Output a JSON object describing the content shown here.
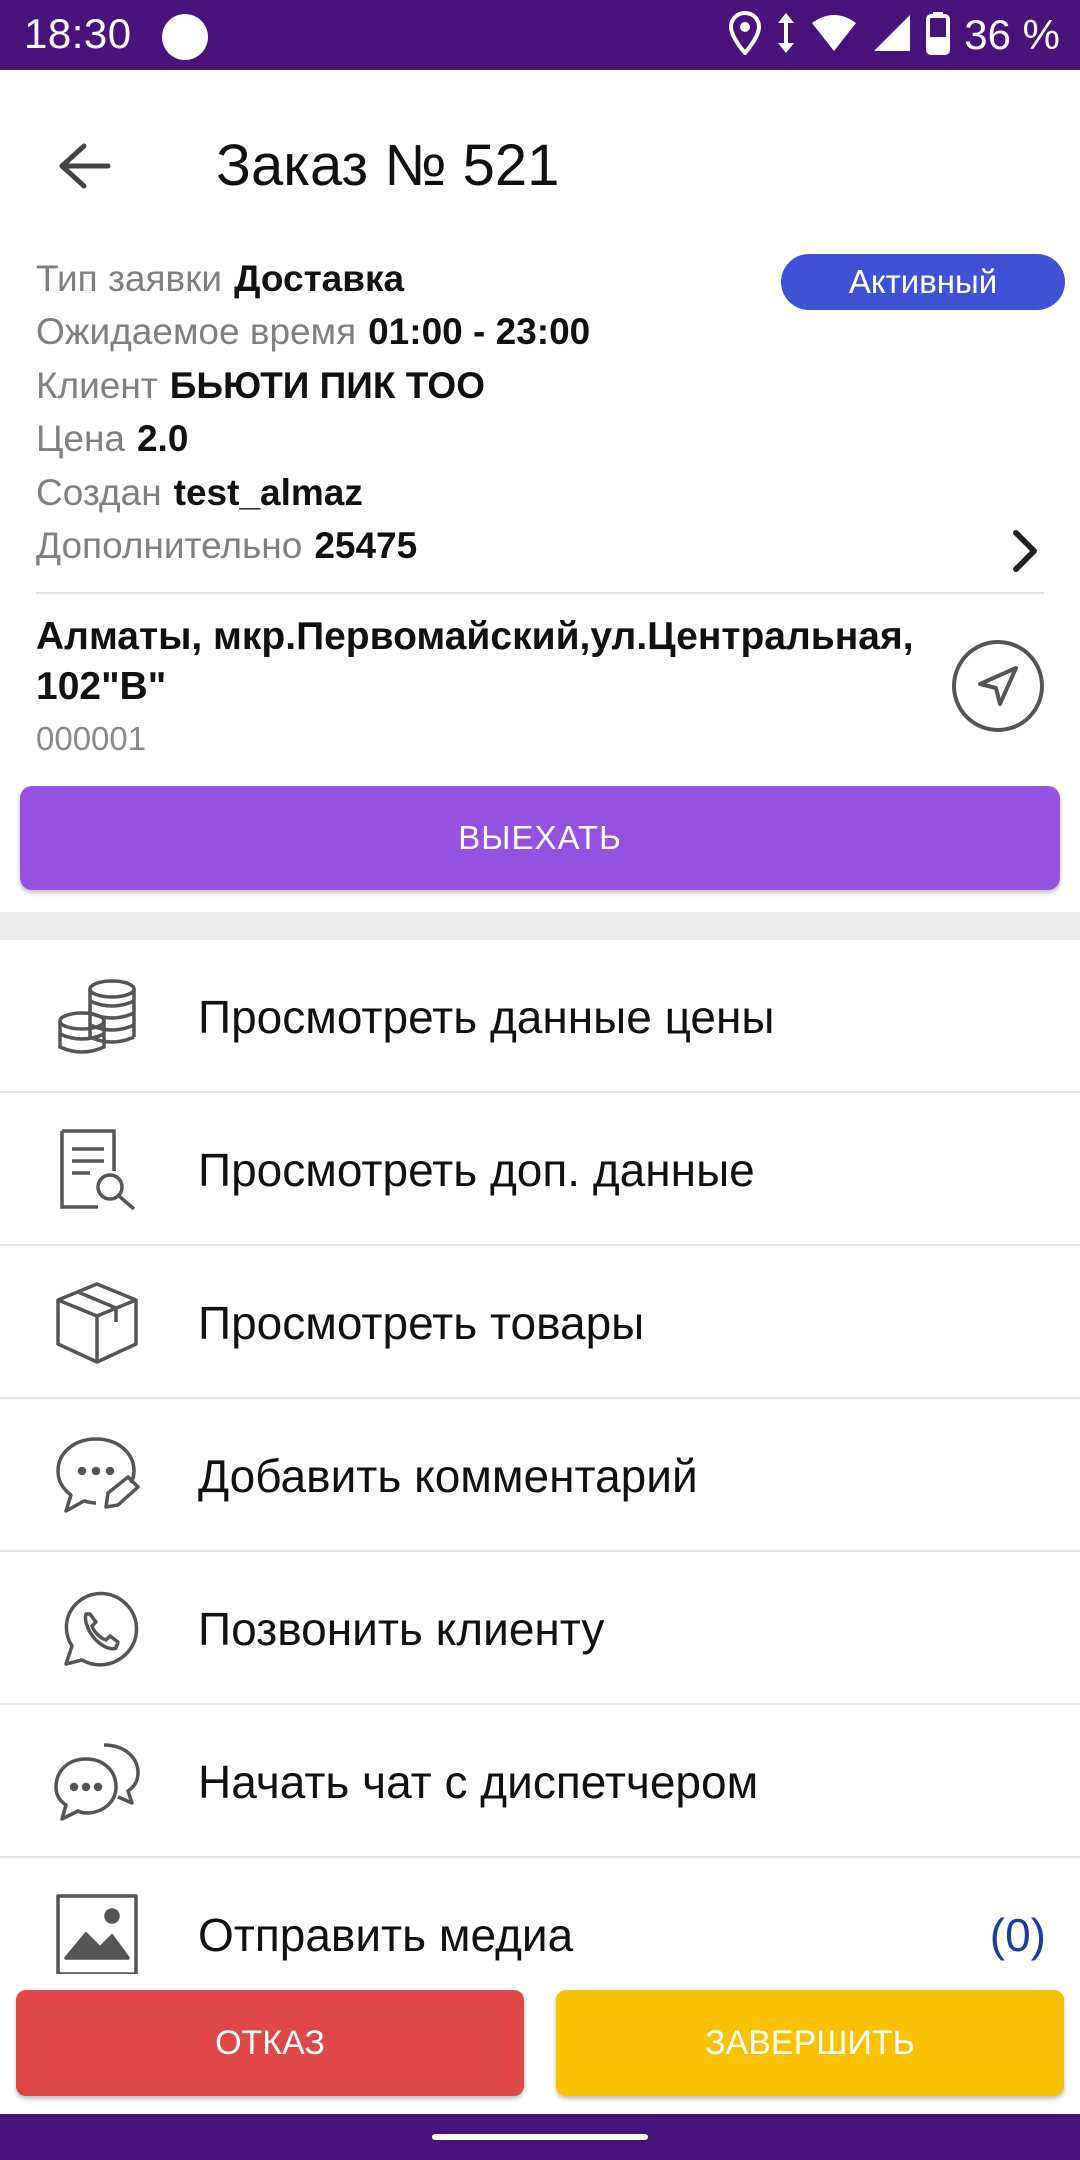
{
  "status_bar": {
    "time": "18:30",
    "battery_text": "36 %",
    "icons": [
      "circle-notification-icon",
      "location-icon",
      "data-arrows-icon",
      "wifi-icon",
      "signal-icon",
      "battery-icon"
    ]
  },
  "header": {
    "title": "Заказ № 521",
    "back_icon": "arrow-left-icon"
  },
  "order": {
    "status_badge": "Активный",
    "fields": [
      {
        "label": "Тип заявки",
        "value": "Доставка"
      },
      {
        "label": "Ожидаемое время",
        "value": "01:00 - 23:00"
      },
      {
        "label": "Клиент",
        "value": "БЬЮТИ ПИК ТОО"
      },
      {
        "label": "Цена",
        "value": "2.0"
      },
      {
        "label": "Создан",
        "value": "test_almaz"
      },
      {
        "label": "Дополнительно",
        "value": "25475"
      }
    ],
    "address": "Алматы, мкр.Первомайский,ул.Центральная, 102\"В\"",
    "address_code": "000001"
  },
  "actions": {
    "depart": "ВЫЕХАТЬ",
    "refuse": "ОТКАЗ",
    "finish": "ЗАВЕРШИТЬ"
  },
  "menu": [
    {
      "label": "Просмотреть данные цены",
      "icon": "coins-icon"
    },
    {
      "label": "Просмотреть доп. данные",
      "icon": "document-search-icon"
    },
    {
      "label": "Просмотреть товары",
      "icon": "box-icon"
    },
    {
      "label": "Добавить комментарий",
      "icon": "comment-edit-icon"
    },
    {
      "label": "Позвонить клиенту",
      "icon": "whatsapp-phone-icon"
    },
    {
      "label": "Начать чат с диспетчером",
      "icon": "chat-bubbles-icon"
    },
    {
      "label": "Отправить медиа",
      "icon": "image-icon",
      "count": "(0)"
    }
  ],
  "colors": {
    "status_bar": "#48137a",
    "badge": "#3f51d5",
    "depart_button": "#9352e0",
    "refuse_button": "#e04848",
    "finish_button": "#f9c200",
    "count_text": "#1d3d9a"
  }
}
